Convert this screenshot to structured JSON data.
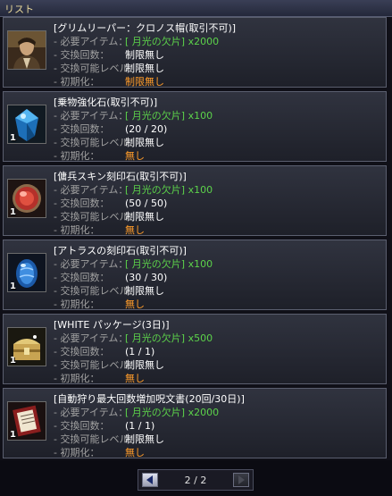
{
  "header": {
    "title": "リスト"
  },
  "labels": {
    "required": "- 必要アイテム：",
    "count": "- 交換回数：",
    "level": "- 交換可能レベル：",
    "init": "- 初期化："
  },
  "items": [
    {
      "name": "[グリムリーパー：クロノス帽(取引不可)]",
      "required": "[ 月光の欠片] x2000",
      "count": "制限無し",
      "level": "制限無し",
      "init": "制限無し",
      "qty": "",
      "icon": "portrait-icon"
    },
    {
      "name": "[乗物強化石(取引不可)]",
      "required": "[ 月光の欠片] x100",
      "count": "(20 / 20)",
      "level": "制限無し",
      "init": "無し",
      "qty": "1",
      "icon": "blue-gem-icon"
    },
    {
      "name": "[傭兵スキン刻印石(取引不可)]",
      "required": "[ 月光の欠片] x100",
      "count": "(50 / 50)",
      "level": "制限無し",
      "init": "無し",
      "qty": "1",
      "icon": "red-stone-icon"
    },
    {
      "name": "[アトラスの刻印石(取引不可)]",
      "required": "[ 月光の欠片] x100",
      "count": "(30 / 30)",
      "level": "制限無し",
      "init": "無し",
      "qty": "1",
      "icon": "blue-egg-icon"
    },
    {
      "name": "[WHITE パッケージ(3日)]",
      "required": "[ 月光の欠片] x500",
      "count": "(1 / 1)",
      "level": "制限無し",
      "init": "無し",
      "qty": "1",
      "icon": "treasure-chest-icon"
    },
    {
      "name": "[自動狩り最大回数増加呪文書(20回/30日)]",
      "required": "[ 月光の欠片] x2000",
      "count": "(1 / 1)",
      "level": "制限無し",
      "init": "無し",
      "qty": "1",
      "icon": "scroll-book-icon"
    }
  ],
  "pagination": {
    "label": "2 / 2"
  },
  "colors": {
    "accent_green": "#5cd24a",
    "accent_orange": "#ff9c2a",
    "header_text": "#e8d89a"
  }
}
